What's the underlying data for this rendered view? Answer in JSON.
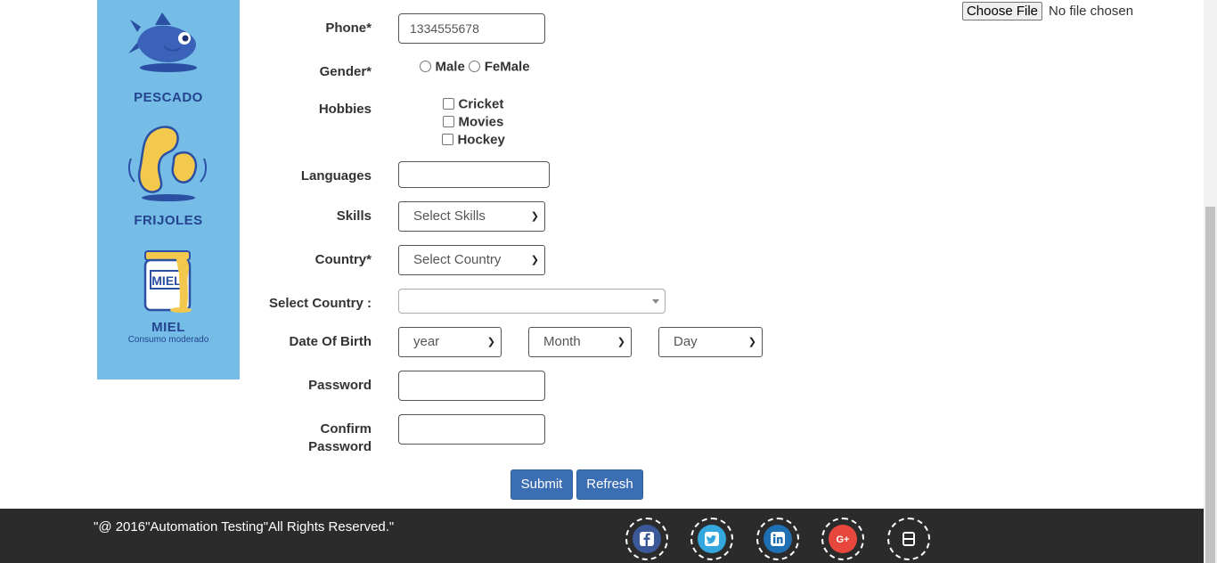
{
  "upload": {
    "button_label": "Choose File",
    "status": "No file chosen"
  },
  "ad": {
    "items": [
      {
        "label": "PESCADO",
        "icon": "fish-icon"
      },
      {
        "label": "FRIJOLES",
        "icon": "beans-icon"
      },
      {
        "label": "MIEL",
        "icon": "honey-jar-icon"
      }
    ],
    "jar_text": "MIEL",
    "tagline": "Consumo moderado"
  },
  "form": {
    "phone": {
      "label": "Phone*",
      "value": "1334555678"
    },
    "gender": {
      "label": "Gender*",
      "options": [
        "Male",
        "FeMale"
      ]
    },
    "hobbies": {
      "label": "Hobbies",
      "options": [
        "Cricket",
        "Movies",
        "Hockey"
      ]
    },
    "languages": {
      "label": "Languages",
      "value": ""
    },
    "skills": {
      "label": "Skills",
      "selected": "Select Skills"
    },
    "country": {
      "label": "Country*",
      "selected": "Select Country"
    },
    "select_country": {
      "label": "Select Country :",
      "selected": ""
    },
    "dob": {
      "label": "Date Of Birth",
      "year": "year",
      "month": "Month",
      "day": "Day"
    },
    "password": {
      "label": "Password",
      "value": ""
    },
    "confirm_password": {
      "label_line1": "Confirm",
      "label_line2": "Password",
      "value": ""
    }
  },
  "buttons": {
    "submit": "Submit",
    "refresh": "Refresh"
  },
  "footer": {
    "copyright": "\"@ 2016\"Automation Testing\"All Rights Reserved.\"",
    "social": [
      {
        "name": "facebook-icon",
        "color": "#3b5998"
      },
      {
        "name": "twitter-icon",
        "color": "#34a7df"
      },
      {
        "name": "linkedin-icon",
        "color": "#1e6fb3"
      },
      {
        "name": "google-plus-icon",
        "color": "#e8473d"
      },
      {
        "name": "youtube-icon",
        "color": "#2b2b2b"
      }
    ]
  }
}
